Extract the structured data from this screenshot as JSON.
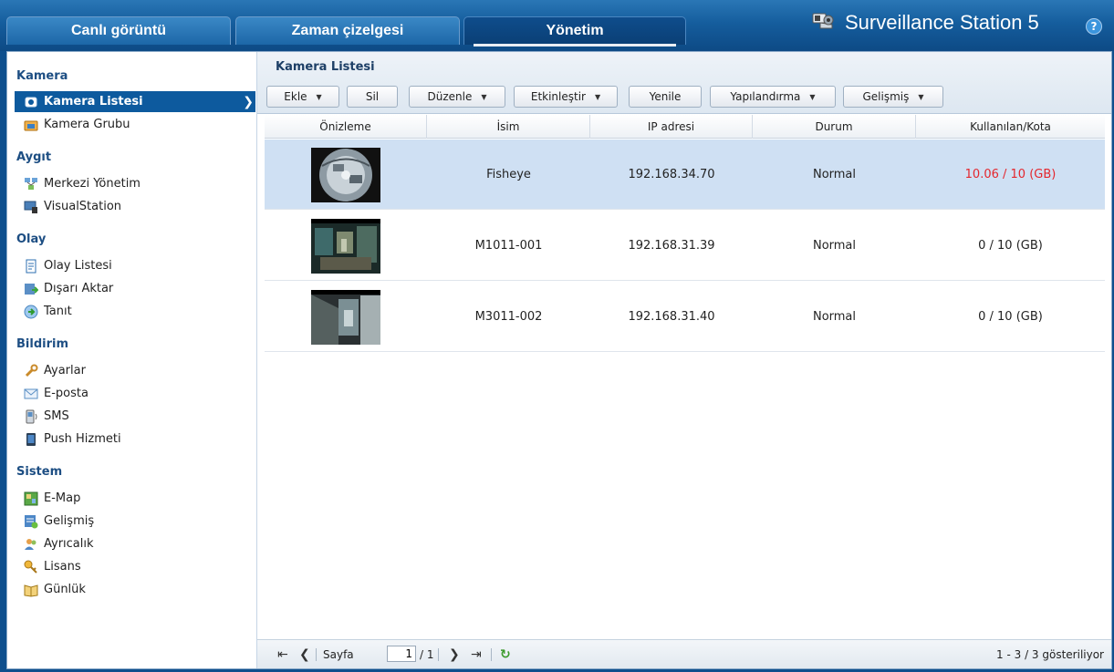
{
  "tabs": [
    {
      "label": "Canlı görüntü"
    },
    {
      "label": "Zaman çizelgesi"
    },
    {
      "label": "Yönetim"
    }
  ],
  "brand": {
    "title": "Surveillance Station 5",
    "help": "?"
  },
  "sidebar": {
    "sections": [
      {
        "title": "Kamera",
        "items": [
          {
            "label": "Kamera Listesi",
            "active": true
          },
          {
            "label": "Kamera Grubu"
          }
        ]
      },
      {
        "title": "Aygıt",
        "items": [
          {
            "label": "Merkezi Yönetim"
          },
          {
            "label": "VisualStation"
          }
        ]
      },
      {
        "title": "Olay",
        "items": [
          {
            "label": "Olay Listesi"
          },
          {
            "label": "Dışarı Aktar"
          },
          {
            "label": "Tanıt"
          }
        ]
      },
      {
        "title": "Bildirim",
        "items": [
          {
            "label": "Ayarlar"
          },
          {
            "label": "E-posta"
          },
          {
            "label": "SMS"
          },
          {
            "label": "Push Hizmeti"
          }
        ]
      },
      {
        "title": "Sistem",
        "items": [
          {
            "label": "E-Map"
          },
          {
            "label": "Gelişmiş"
          },
          {
            "label": "Ayrıcalık"
          },
          {
            "label": "Lisans"
          },
          {
            "label": "Günlük"
          }
        ]
      }
    ]
  },
  "panel": {
    "title": "Kamera Listesi"
  },
  "toolbar": {
    "ekle": "Ekle",
    "sil": "Sil",
    "duzenle": "Düzenle",
    "etkinlestir": "Etkinleştir",
    "yenile": "Yenile",
    "yapilandirma": "Yapılandırma",
    "gelismis": "Gelişmiş"
  },
  "table": {
    "columns": [
      "Önizleme",
      "İsim",
      "IP adresi",
      "Durum",
      "Kullanılan/Kota"
    ],
    "rows": [
      {
        "name": "Fisheye",
        "ip": "192.168.34.70",
        "status": "Normal",
        "quota": "10.06 / 10 (GB)",
        "over_quota": true
      },
      {
        "name": "M1011-001",
        "ip": "192.168.31.39",
        "status": "Normal",
        "quota": "0 / 10 (GB)",
        "over_quota": false
      },
      {
        "name": "M3011-002",
        "ip": "192.168.31.40",
        "status": "Normal",
        "quota": "0 / 10 (GB)",
        "over_quota": false
      }
    ]
  },
  "pager": {
    "page_label": "Sayfa",
    "page_value": "1",
    "page_total": "/ 1",
    "summary": "1 - 3 / 3 gösteriliyor"
  },
  "colors": {
    "accent": "#0d5a9e",
    "over_quota": "#e4262d",
    "selected_row": "#cfe0f3"
  }
}
